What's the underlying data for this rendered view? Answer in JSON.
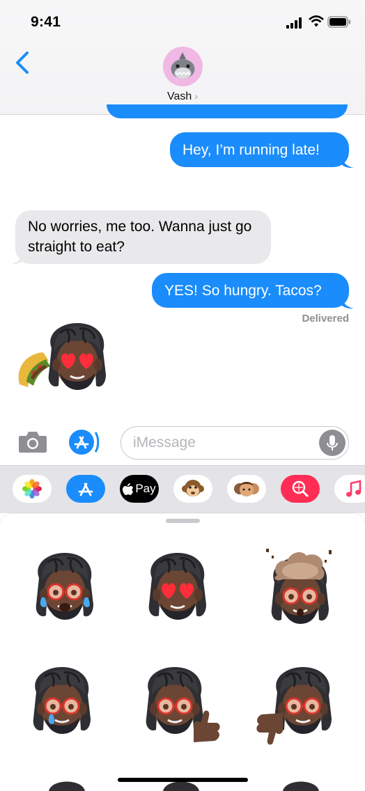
{
  "status_bar": {
    "time": "9:41"
  },
  "header": {
    "contact_name": "Vash",
    "chevron": "›",
    "avatar_icon": "shark-memoji-icon"
  },
  "messages": [
    {
      "direction": "outgoing",
      "text": "Hey, I’m running late!"
    },
    {
      "direction": "incoming",
      "text": "No worries, me too. Wanna just go straight to eat?"
    },
    {
      "direction": "outgoing",
      "text": "YES! So hungry. Tacos?"
    }
  ],
  "delivery_status": "Delivered",
  "input": {
    "placeholder": "iMessage"
  },
  "apps": {
    "apple_pay_label": "Pay",
    "items": [
      "photos-app-icon",
      "app-store-icon",
      "apple-pay-icon",
      "animoji-monkey-icon",
      "memoji-stickers-icon",
      "web-images-search-icon",
      "music-app-icon"
    ]
  },
  "colors": {
    "outgoing_bubble": "#1a8cfb",
    "incoming_bubble": "#e9e9eb",
    "accent": "#1a8cfb",
    "avatar_bg": "#f0b8e4"
  },
  "stickers": [
    "memoji-crying-laughing",
    "memoji-heart-eyes",
    "memoji-mind-blown",
    "memoji-crying",
    "memoji-thumbs-up",
    "memoji-thumbs-down"
  ]
}
